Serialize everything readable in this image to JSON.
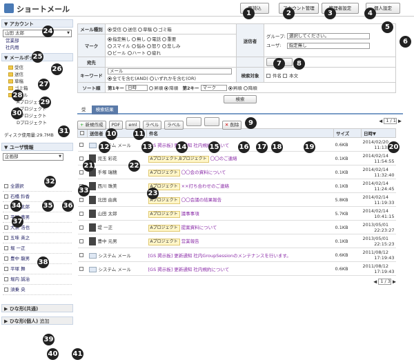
{
  "app": {
    "title": "ショートメール"
  },
  "header_buttons": [
    "再読込",
    "アカウント管理",
    "管理者設定",
    "個人設定"
  ],
  "sidebar": {
    "account_title": "▼ アカウント",
    "account_select": "山田 太郎",
    "account_links": [
      "営業部",
      "社内用"
    ],
    "mailbox_title": "▼ メールボックス",
    "folders": [
      "受信",
      "送信",
      "草稿",
      "ゴミ箱",
      "ラベル"
    ],
    "labels": [
      "Aプロジェクト",
      "Bプロジェクト",
      "Cプロジェクト",
      "Dプロジェクト"
    ],
    "disk_usage": "ディスク使用量:29.7MB",
    "userinfo_title": "▼ ユーザ情報",
    "group_select": "企画部",
    "select_all": "全選択",
    "users": [
      "石橋 鈴香",
      "山田 太郎",
      "平尾 喜男",
      "大泉 浩也",
      "五味 英之",
      "堀 一正",
      "豊中 龍男",
      "平塚 舞",
      "堀内 誠治",
      "須乗 央"
    ],
    "tpl_common": "ひな形(共通)",
    "tpl_personal": "ひな形(個人)",
    "tpl_personal_extra": "追加"
  },
  "search": {
    "mail_type_label": "メール種別",
    "mail_types": [
      "受信",
      "送信",
      "草稿",
      "ゴミ箱"
    ],
    "sender_label": "送信者",
    "group_label": "グループ:",
    "group_value": "選択してください。",
    "user_label": "ユーザ:",
    "user_value": "指定無し",
    "mark_label": "マーク",
    "marks": [
      "指定無し",
      "無し",
      "電話",
      "重要",
      "スマイル",
      "悩み",
      "怒り",
      "悲しみ",
      "ビール",
      "ハート",
      "疲れ"
    ],
    "dest_label": "宛先",
    "keyword_label": "キーワード",
    "keyword_value": "メール",
    "keyword_modes": [
      "全てを含む(AND)",
      "いずれかを含む(OR)"
    ],
    "target_label": "検索対象",
    "targets": [
      "件名",
      "本文"
    ],
    "sort_label": "ソート順",
    "key1_label": "第1キー",
    "key1_value": "日時",
    "key2_label": "第2キー",
    "key2_value": "マーク",
    "orders": [
      "昇順",
      "降順"
    ],
    "search_button": "検索"
  },
  "tabs": {
    "inbox": "受",
    "result": "検索結果"
  },
  "toolbar": [
    "新規作成",
    "PDF",
    "eml",
    "ラベル",
    "ラベル",
    "",
    "",
    "削除"
  ],
  "paging": "1 / 1",
  "paging_bottom": "1 / 3",
  "columns": [
    "送信者",
    "件名",
    "サイズ",
    "日時▼"
  ],
  "rows": [
    {
      "sender": "システム メール",
      "tags": [],
      "subject": "[GS 掲示板] 更新通知 社内規約について",
      "size": "0.6KB",
      "date": "2014/02/20",
      "time": "11:13:03"
    },
    {
      "sender": "児玉 彩花",
      "tags": [
        "Aプロジェクト,Bプロジェクト"
      ],
      "subject": "〇〇のご連絡",
      "size": "0.1KB",
      "date": "2014/02/14",
      "time": "11:54:55"
    },
    {
      "sender": "手塚 瑞穂",
      "tags": [
        "Aプロジェクト"
      ],
      "subject": "〇〇会の資料について",
      "size": "0.1KB",
      "date": "2014/02/14",
      "time": "11:32:40"
    },
    {
      "sender": "西川 珠美",
      "tags": [
        "Aプロジェクト"
      ],
      "subject": "××打ち合わせのご連絡",
      "size": "0.1KB",
      "date": "2014/02/14",
      "time": "11:24:45"
    },
    {
      "sender": "北田 由真",
      "tags": [
        "Aプロジェクト"
      ],
      "subject": "〇〇会議の結果報告",
      "size": "5.8KB",
      "date": "2014/02/14",
      "time": "11:19:33"
    },
    {
      "sender": "山田 太郎",
      "tags": [
        "Aプロジェクト"
      ],
      "subject": "議事事項",
      "size": "5.7KB",
      "date": "2014/02/14",
      "time": "10:41:15"
    },
    {
      "sender": "堤 一正",
      "tags": [
        "Aプロジェクト"
      ],
      "subject": "提案資料について",
      "size": "0.1KB",
      "date": "2013/05/01",
      "time": "22:23:27"
    },
    {
      "sender": "豊中 元男",
      "tags": [
        "Aプロジェクト"
      ],
      "subject": "営業報告",
      "size": "0.1KB",
      "date": "2013/05/01",
      "time": "22:15:23"
    },
    {
      "sender": "システム メール",
      "tags": [],
      "subject": "[GS 掲示板] 更新通知 社内GroupSessionのメンテナンスを行います。",
      "size": "0.6KB",
      "date": "2011/08/12",
      "time": "17:19:43"
    },
    {
      "sender": "システム メール",
      "tags": [],
      "subject": "[GS 掲示板] 更新通知 社内規約について",
      "size": "0.6KB",
      "date": "2011/08/12",
      "time": "17:19:43"
    }
  ],
  "markers": [
    "1",
    "2",
    "3",
    "4",
    "5",
    "6",
    "7",
    "8",
    "9",
    "10",
    "11",
    "12",
    "13",
    "14",
    "15",
    "16",
    "17",
    "18",
    "19",
    "20",
    "21",
    "22",
    "23",
    "24",
    "25",
    "26",
    "27",
    "28",
    "29",
    "30",
    "31",
    "32",
    "33",
    "34",
    "35",
    "36",
    "37",
    "38",
    "39",
    "40",
    "41"
  ]
}
